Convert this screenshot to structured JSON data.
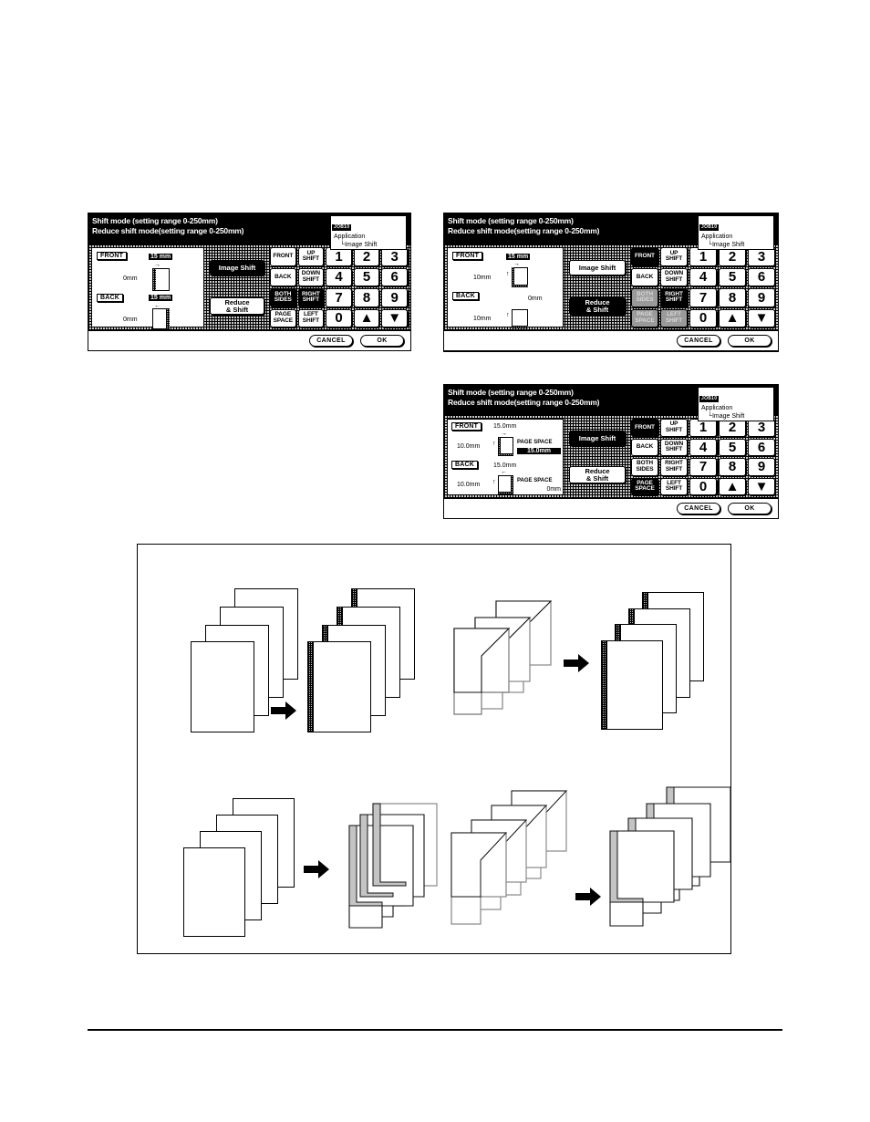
{
  "document": {
    "panels": [
      {
        "id": "panel-image-shift-both-sides",
        "header": {
          "line1": "Shift mode (setting range 0-250mm)",
          "line2": "Reduce shift mode(setting range 0-250mm)",
          "job_id": "JOB10",
          "app_line1": "Application",
          "app_line2": "└Image Shift"
        },
        "preview": {
          "front_label": "FRONT",
          "back_label": "BACK",
          "front_top_value": "15 mm",
          "front_top_highlight": true,
          "front_side_value": "0mm",
          "front_arrow": "→",
          "back_top_value": "15 mm",
          "back_top_highlight": true,
          "back_side_value": "0mm",
          "back_arrow": "←"
        },
        "modes": [
          {
            "label": "Image Shift",
            "selected": true
          },
          {
            "label": "Reduce\n     & Shift",
            "selected": false
          }
        ],
        "keys": [
          {
            "label": "FRONT",
            "state": "normal"
          },
          {
            "label": "UP\nSHIFT",
            "state": "normal"
          },
          {
            "label": "1",
            "state": "normal"
          },
          {
            "label": "2",
            "state": "normal"
          },
          {
            "label": "3",
            "state": "normal"
          },
          {
            "label": "BACK",
            "state": "normal"
          },
          {
            "label": "DOWN\nSHIFT",
            "state": "normal"
          },
          {
            "label": "4",
            "state": "normal"
          },
          {
            "label": "5",
            "state": "normal"
          },
          {
            "label": "6",
            "state": "normal"
          },
          {
            "label": "BOTH\nSIDES",
            "state": "selected"
          },
          {
            "label": "RIGHT\nSHIFT",
            "state": "selected"
          },
          {
            "label": "7",
            "state": "normal"
          },
          {
            "label": "8",
            "state": "normal"
          },
          {
            "label": "9",
            "state": "normal"
          },
          {
            "label": "PAGE\nSPACE",
            "state": "normal"
          },
          {
            "label": "LEFT\nSHIFT",
            "state": "normal"
          },
          {
            "label": "0",
            "state": "normal"
          },
          {
            "label": "▲",
            "state": "normal"
          },
          {
            "label": "▼",
            "state": "normal"
          }
        ],
        "footer": {
          "cancel": "CANCEL",
          "ok": "OK"
        }
      },
      {
        "id": "panel-reduce-shift-front",
        "header": {
          "line1": "Shift mode (setting range 0-250mm)",
          "line2": "Reduce shift mode(setting range 0-250mm)",
          "job_id": "JOB10",
          "app_line1": "Application",
          "app_line2": "└Image Shift"
        },
        "preview": {
          "front_label": "FRONT",
          "back_label": "BACK",
          "front_top_value": "15 mm",
          "front_top_highlight": true,
          "front_side_value": "10mm",
          "front_arrow": "→",
          "back_top_value": "0mm",
          "back_top_highlight": false,
          "back_side_value": "10mm",
          "back_arrow": ""
        },
        "modes": [
          {
            "label": "Image Shift",
            "selected": false
          },
          {
            "label": "Reduce\n     & Shift",
            "selected": true
          }
        ],
        "keys": [
          {
            "label": "FRONT",
            "state": "selected"
          },
          {
            "label": "UP\nSHIFT",
            "state": "normal"
          },
          {
            "label": "1",
            "state": "normal"
          },
          {
            "label": "2",
            "state": "normal"
          },
          {
            "label": "3",
            "state": "normal"
          },
          {
            "label": "BACK",
            "state": "normal"
          },
          {
            "label": "DOWN\nSHIFT",
            "state": "normal"
          },
          {
            "label": "4",
            "state": "normal"
          },
          {
            "label": "5",
            "state": "normal"
          },
          {
            "label": "6",
            "state": "normal"
          },
          {
            "label": "BOTH\nSIDES",
            "state": "disabled"
          },
          {
            "label": "RIGHT\nSHIFT",
            "state": "selected"
          },
          {
            "label": "7",
            "state": "normal"
          },
          {
            "label": "8",
            "state": "normal"
          },
          {
            "label": "9",
            "state": "normal"
          },
          {
            "label": "PAGE\nSPACE",
            "state": "disabled"
          },
          {
            "label": "LEFT\nSHIFT",
            "state": "disabled"
          },
          {
            "label": "0",
            "state": "normal"
          },
          {
            "label": "▲",
            "state": "normal"
          },
          {
            "label": "▼",
            "state": "normal"
          }
        ],
        "footer": {
          "cancel": "CANCEL",
          "ok": "OK"
        }
      },
      {
        "id": "panel-page-space",
        "header": {
          "line1": "Shift mode (setting range 0-250mm)",
          "line2": "Reduce shift mode(setting range 0-250mm)",
          "job_id": "JOB10",
          "app_line1": "Application",
          "app_line2": "└Image Shift"
        },
        "preview": {
          "front_label": "FRONT",
          "back_label": "BACK",
          "front_top_value": "15.0mm",
          "front_top_highlight": false,
          "front_side_value": "10.0mm",
          "front_arrow": "→",
          "front_space_label": "PAGE SPACE",
          "front_space_value": "15.0mm",
          "front_space_highlight": true,
          "back_top_value": "15.0mm",
          "back_top_highlight": false,
          "back_side_value": "10.0mm",
          "back_arrow": "←",
          "back_space_label": "PAGE SPACE",
          "back_space_value": "0mm",
          "back_space_highlight": false
        },
        "modes": [
          {
            "label": "Image Shift",
            "selected": true
          },
          {
            "label": "Reduce\n     & Shift",
            "selected": false
          }
        ],
        "keys": [
          {
            "label": "FRONT",
            "state": "selected"
          },
          {
            "label": "UP\nSHIFT",
            "state": "normal"
          },
          {
            "label": "1",
            "state": "normal"
          },
          {
            "label": "2",
            "state": "normal"
          },
          {
            "label": "3",
            "state": "normal"
          },
          {
            "label": "BACK",
            "state": "normal"
          },
          {
            "label": "DOWN\nSHIFT",
            "state": "normal"
          },
          {
            "label": "4",
            "state": "normal"
          },
          {
            "label": "5",
            "state": "normal"
          },
          {
            "label": "6",
            "state": "normal"
          },
          {
            "label": "BOTH\nSIDES",
            "state": "normal"
          },
          {
            "label": "RIGHT\nSHIFT",
            "state": "normal"
          },
          {
            "label": "7",
            "state": "normal"
          },
          {
            "label": "8",
            "state": "normal"
          },
          {
            "label": "9",
            "state": "normal"
          },
          {
            "label": "PAGE\nSPACE",
            "state": "selected"
          },
          {
            "label": "LEFT\nSHIFT",
            "state": "normal"
          },
          {
            "label": "0",
            "state": "normal"
          },
          {
            "label": "▲",
            "state": "normal"
          },
          {
            "label": "▼",
            "state": "normal"
          }
        ],
        "footer": {
          "cancel": "CANCEL",
          "ok": "OK"
        }
      }
    ],
    "illustrations": {
      "top_left": {
        "name": "image-shift-simple-stack"
      },
      "top_right": {
        "name": "image-shift-folded-stack"
      },
      "bottom_left": {
        "name": "reduce-shift-simple-stack"
      },
      "bottom_right": {
        "name": "reduce-shift-folded-stack"
      }
    },
    "colors": {
      "lcd_background": "#000000",
      "lcd_text": "#ffffff",
      "button_face": "#ffffff",
      "button_selected": "#000000",
      "button_disabled": "#9a9a9a",
      "panel_dither": "#c9c9c9"
    }
  }
}
